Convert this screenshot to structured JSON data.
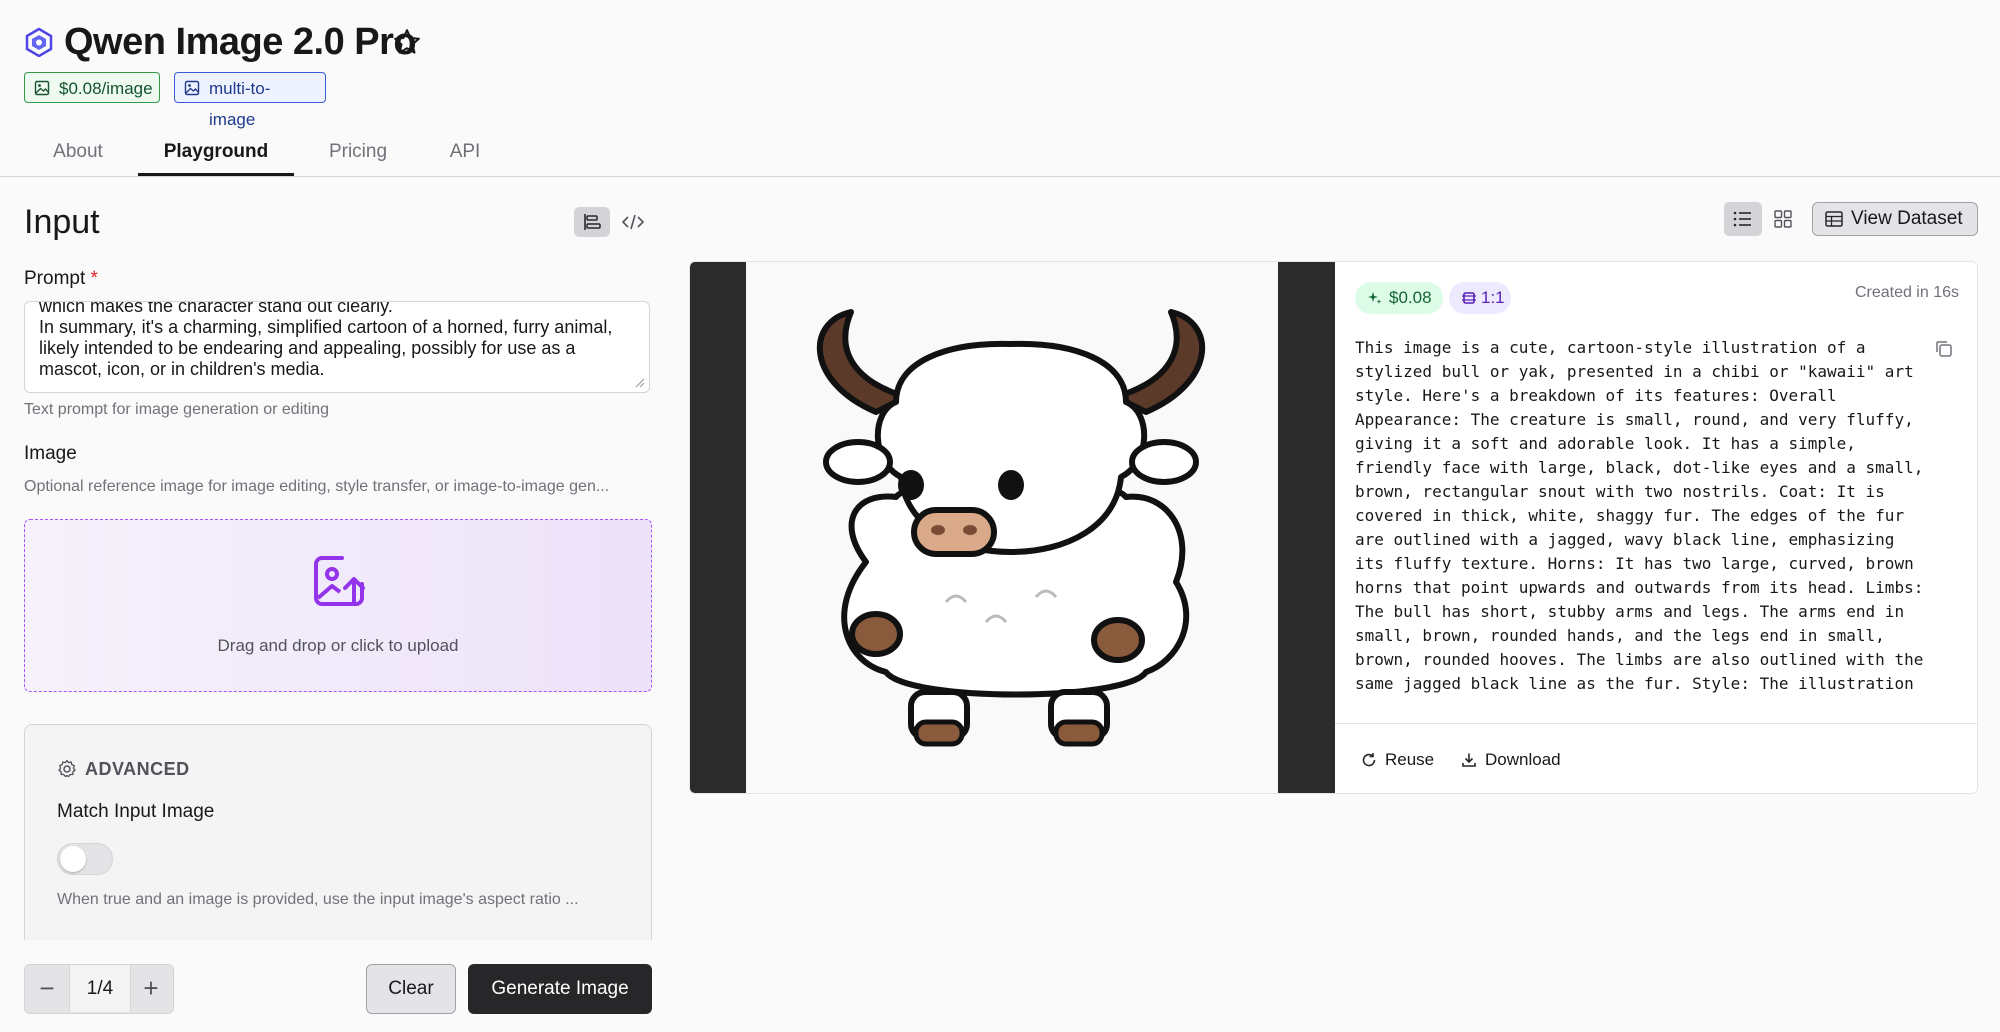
{
  "header": {
    "title": "Qwen Image 2.0 Pro",
    "badges": {
      "price": "$0.08/image",
      "type": "multi-to-image"
    }
  },
  "tabs": [
    {
      "label": "About",
      "active": false
    },
    {
      "label": "Playground",
      "active": true
    },
    {
      "label": "Pricing",
      "active": false
    },
    {
      "label": "API",
      "active": false
    }
  ],
  "input": {
    "title": "Input",
    "prompt": {
      "label": "Prompt",
      "required_mark": "*",
      "value": "which makes the character stand out clearly.\nIn summary, it's a charming, simplified cartoon of a horned, furry animal, likely intended to be endearing and appealing, possibly for use as a mascot, icon, or in children's media.",
      "help": "Text prompt for image generation or editing"
    },
    "image": {
      "label": "Image",
      "help": "Optional reference image for image editing, style transfer, or image-to-image gen...",
      "dropzone_text": "Drag and drop or click to upload"
    },
    "advanced": {
      "heading": "ADVANCED",
      "match_label": "Match Input Image",
      "match_value": false,
      "match_help": "When true and an image is provided, use the input image's aspect ratio ..."
    },
    "stepper": {
      "minus": "−",
      "value": "1/4",
      "plus": "+"
    },
    "clear_label": "Clear",
    "generate_label": "Generate Image"
  },
  "output": {
    "view_dataset_label": "View Dataset",
    "cost_chip": "$0.08",
    "ratio_chip": "1:1",
    "created": "Created in 16s",
    "description": "This image is a cute, cartoon-style illustration of a stylized bull or yak, presented in a chibi or \"kawaii\" art style. Here's a breakdown of its features: Overall Appearance: The creature is small, round, and very fluffy, giving it a soft and adorable look. It has a simple, friendly face with large, black, dot-like eyes and a small, brown, rectangular snout with two nostrils. Coat: It is covered in thick, white, shaggy fur. The edges of the fur are outlined with a jagged, wavy black line, emphasizing its fluffy texture. Horns: It has two large, curved, brown horns that point upwards and outwards from its head. Limbs: The bull has short, stubby arms and legs. The arms end in small, brown, rounded hands, and the legs end in small, brown, rounded hooves. The limbs are also outlined with the same jagged black line as the fur. Style: The illustration uses bold black outlines and flat",
    "reuse_label": "Reuse",
    "download_label": "Download"
  },
  "colors": {
    "primary_button": "#27272a",
    "price_badge": "#2f9a4a",
    "type_badge": "#3b5bd6",
    "dropzone_border": "#a855f7"
  },
  "icons": [
    "app-logo-icon",
    "star-icon",
    "image-icon",
    "form-view-icon",
    "code-view-icon",
    "upload-image-icon",
    "gear-icon",
    "list-view-icon",
    "grid-view-icon",
    "table-icon",
    "sparkle-icon",
    "aspect-ratio-icon",
    "copy-icon",
    "refresh-icon",
    "download-icon"
  ]
}
